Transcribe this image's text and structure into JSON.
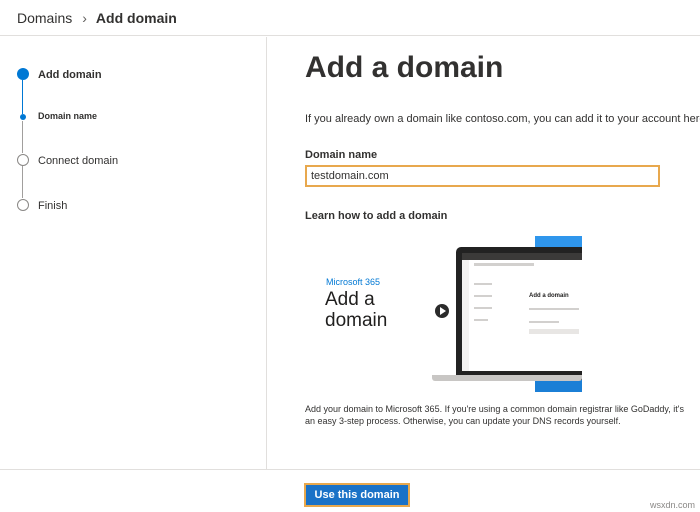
{
  "breadcrumb": {
    "root": "Domains",
    "current": "Add domain"
  },
  "steps": [
    {
      "label": "Add domain",
      "state": "active"
    },
    {
      "label": "Domain name",
      "state": "current-substep"
    },
    {
      "label": "Connect domain",
      "state": "upcoming"
    },
    {
      "label": "Finish",
      "state": "upcoming"
    }
  ],
  "main": {
    "title": "Add a domain",
    "intro": "If you already own a domain like contoso.com, you can add it to your account here.",
    "domain_label": "Domain name",
    "domain_value": "testdomain.com",
    "learn_heading": "Learn how to add a domain",
    "video": {
      "brand": "Microsoft 365",
      "title": "Add a domain",
      "screen_title": "Add a domain"
    },
    "description": "Add your domain to Microsoft 365. If you're using a common domain registrar like GoDaddy, it's an easy 3-step process. Otherwise, you can update your DNS records yourself."
  },
  "footer": {
    "primary_button": "Use this domain",
    "watermark": "wsxdn.com"
  },
  "colors": {
    "accent": "#0078d4",
    "focus_border": "#e8a84d",
    "button_bg": "#1a72c7"
  },
  "icons": {
    "breadcrumb_separator": "chevron-right-icon",
    "video_play": "play-icon"
  }
}
